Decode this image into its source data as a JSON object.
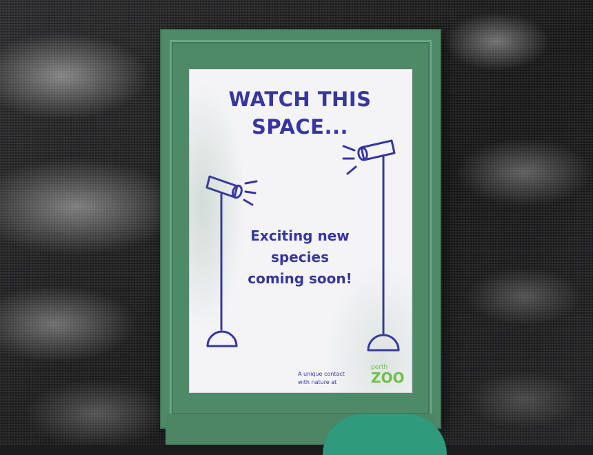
{
  "sign": {
    "title_line1": "WATCH THIS",
    "title_line2": "SPACE...",
    "message_line1": "Exciting new",
    "message_line2": "species",
    "message_line3": "coming soon!",
    "tagline_line1": "A unique contact",
    "tagline_line2": "with nature at",
    "logo_small": "perth",
    "logo_big": "ZOO"
  },
  "colors": {
    "ink": "#3636a0",
    "frame_green": "#4f8a68",
    "logo_green": "#6cc04a",
    "background": "#1c1c1e"
  },
  "icons": [
    "spotlight-left-icon",
    "spotlight-right-icon"
  ]
}
